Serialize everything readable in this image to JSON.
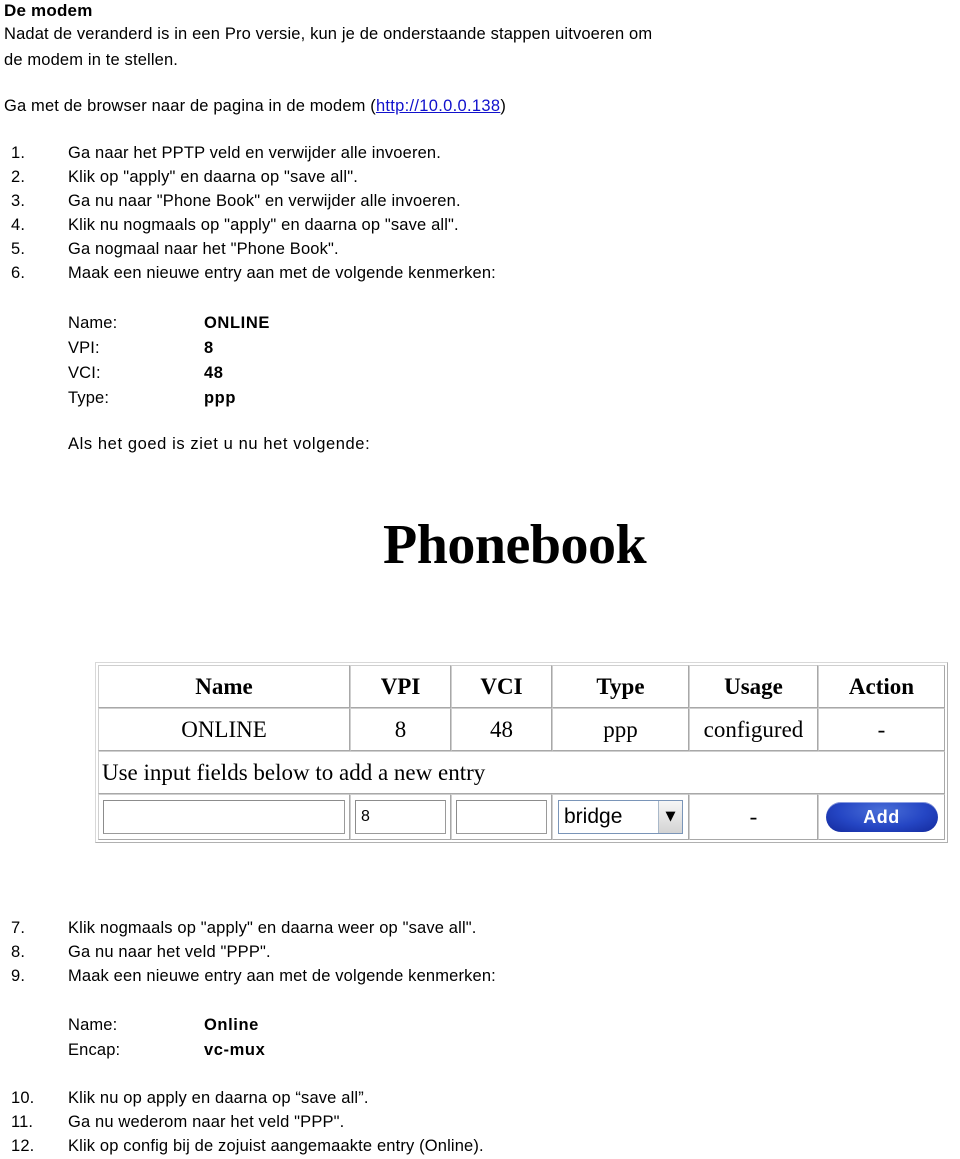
{
  "document": {
    "title": "De modem",
    "intro_line1": "Nadat de veranderd is in een Pro versie, kun je de onderstaande stappen uitvoeren om",
    "intro_line2": "de modem in te stellen.",
    "browse_prefix": "Ga met de browser naar de pagina in de modem (",
    "browse_link": "http://10.0.0.138",
    "browse_suffix": ")"
  },
  "steps_first": [
    {
      "num": "1.",
      "text": "Ga naar het PPTP veld en verwijder alle invoeren."
    },
    {
      "num": "2.",
      "text": "Klik op \"apply\" en daarna op \"save all\"."
    },
    {
      "num": "3.",
      "text": "Ga nu naar \"Phone Book\" en verwijder alle invoeren."
    },
    {
      "num": "4.",
      "text": "Klik nu nogmaals op \"apply\" en daarna op \"save all\"."
    },
    {
      "num": "5.",
      "text": "Ga nogmaal naar het \"Phone Book\"."
    },
    {
      "num": "6.",
      "text": "Maak een nieuwe entry aan met de volgende kenmerken:"
    }
  ],
  "entry_first": [
    {
      "key": "Name:",
      "value": "ONLINE"
    },
    {
      "key": "VPI:",
      "value": "8"
    },
    {
      "key": "VCI:",
      "value": "48"
    },
    {
      "key": "Type:",
      "value": "ppp"
    }
  ],
  "note_first": "Als het goed is ziet u nu het volgende:",
  "screenshot": {
    "heading": "Phonebook",
    "columns": [
      "Name",
      "VPI",
      "VCI",
      "Type",
      "Usage",
      "Action"
    ],
    "rows": [
      {
        "name": "ONLINE",
        "vpi": "8",
        "vci": "48",
        "type": "ppp",
        "usage": "configured",
        "action": "-"
      }
    ],
    "hint_row": "Use input fields below to add a new entry",
    "input_row": {
      "name_value": "",
      "name_placeholder": "",
      "vpi_value": "8",
      "vci_value": "",
      "type_selected": "bridge",
      "type_arrow_icon": "chevron-down-icon",
      "usage_value": "-",
      "add_button_label": "Add"
    },
    "colors": {
      "add_button": "#2546c4",
      "table_border": "#a8a8a8",
      "select_border": "#7a95b8"
    }
  },
  "steps_second": [
    {
      "num": "7.",
      "text": "Klik nogmaals op \"apply\" en daarna weer op \"save all\"."
    },
    {
      "num": "8.",
      "text": "Ga nu naar het veld \"PPP\"."
    },
    {
      "num": "9.",
      "text": "Maak een nieuwe entry aan met de volgende kenmerken:"
    }
  ],
  "entry_second": [
    {
      "key": "Name:",
      "value": "Online"
    },
    {
      "key": "Encap:",
      "value": "vc-mux"
    }
  ],
  "steps_third": [
    {
      "num": "10.",
      "text": "Klik nu op apply en daarna op “save all”."
    },
    {
      "num": "11.",
      "text": "Ga nu wederom naar het veld \"PPP\"."
    },
    {
      "num": "12.",
      "text": "Klik op config bij de zojuist aangemaakte entry (Online)."
    }
  ]
}
